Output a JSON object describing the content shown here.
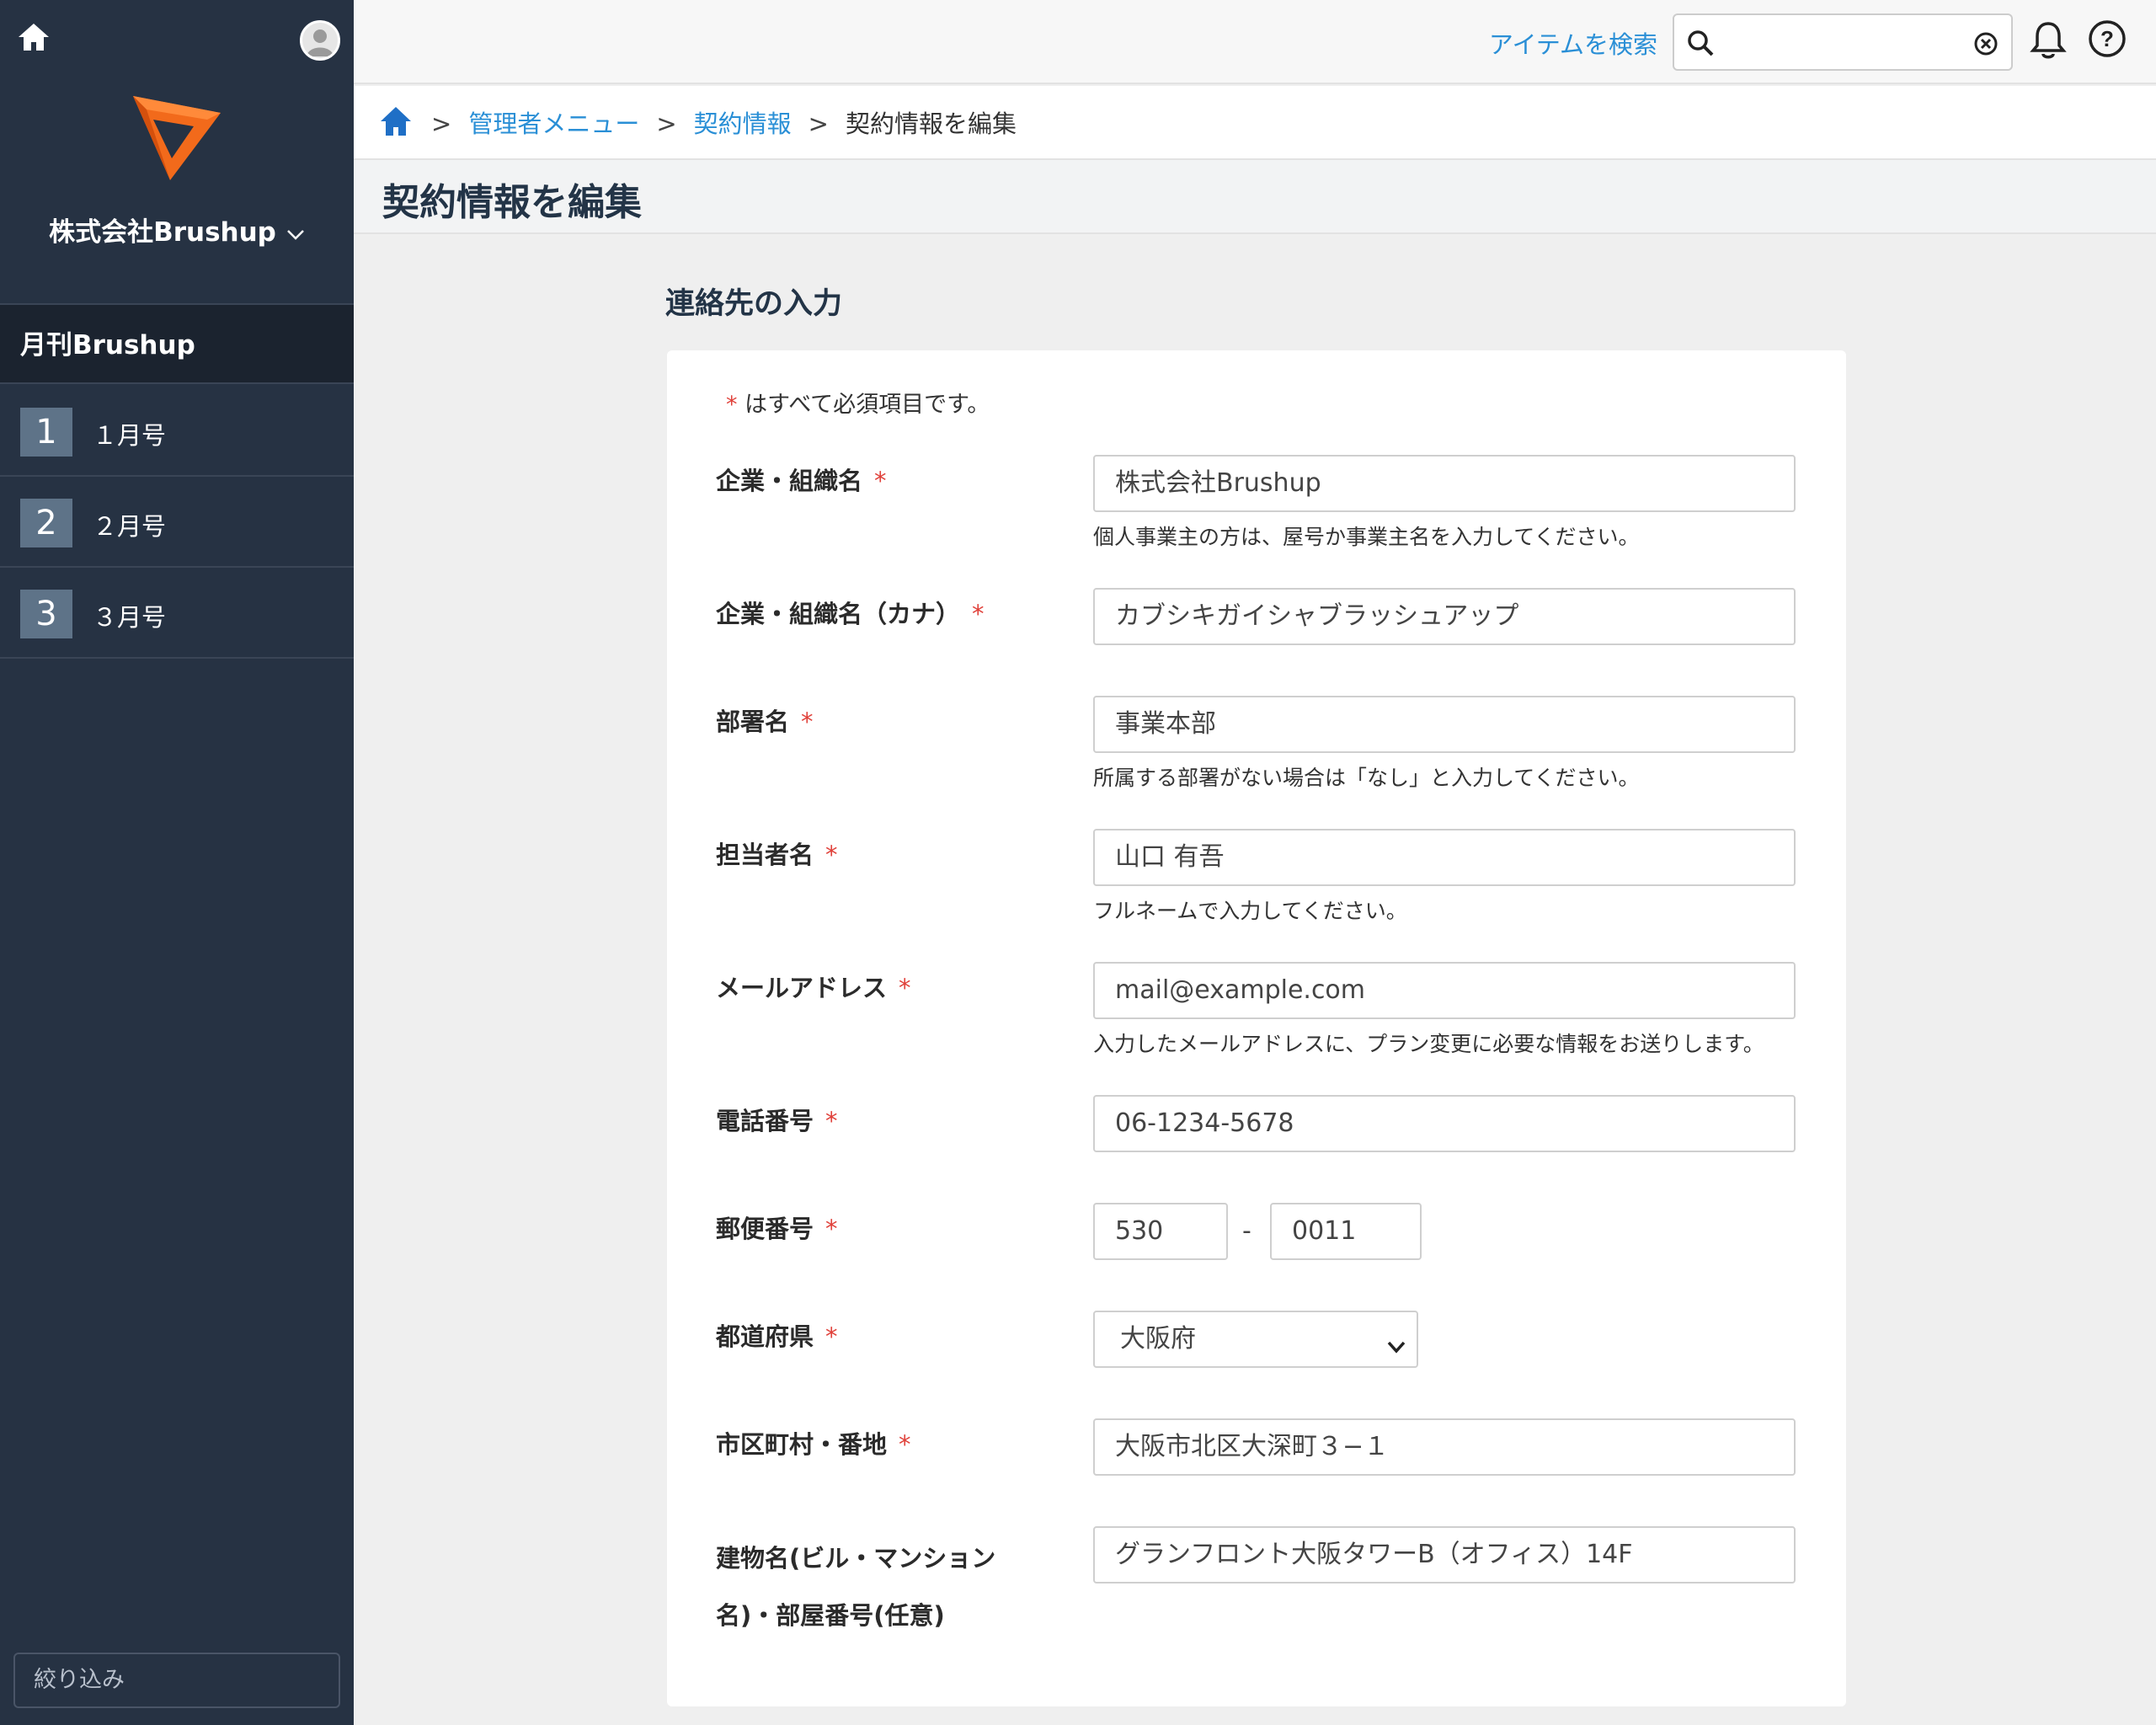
{
  "sidebar": {
    "company": "株式会社Brushup",
    "section": "月刊Brushup",
    "items": [
      {
        "num": "1",
        "label": "１月号"
      },
      {
        "num": "2",
        "label": "２月号"
      },
      {
        "num": "3",
        "label": "３月号"
      }
    ],
    "filter_placeholder": "絞り込み"
  },
  "topbar": {
    "search_link": "アイテムを検索",
    "search_value": ""
  },
  "breadcrumb": {
    "sep": ">",
    "items": [
      "管理者メニュー",
      "契約情報"
    ],
    "current": "契約情報を編集"
  },
  "page": {
    "title": "契約情報を編集"
  },
  "form": {
    "section_title": "連絡先の入力",
    "required_star": "*",
    "required_note": "はすべて必須項目です。",
    "fields": {
      "company": {
        "label": "企業・組織名",
        "value": "株式会社Brushup",
        "hint": "個人事業主の方は、屋号か事業主名を入力してください。"
      },
      "company_kana": {
        "label": "企業・組織名（カナ）",
        "value": "カブシキガイシャブラッシュアップ"
      },
      "department": {
        "label": "部署名",
        "value": "事業本部",
        "hint": "所属する部署がない場合は「なし」と入力してください。"
      },
      "contact": {
        "label": "担当者名",
        "value": "山口 有吾",
        "hint": "フルネームで入力してください。"
      },
      "email": {
        "label": "メールアドレス",
        "value": "mail@example.com",
        "hint": "入力したメールアドレスに、プラン変更に必要な情報をお送りします。"
      },
      "phone": {
        "label": "電話番号",
        "value": "06-1234-5678"
      },
      "postal": {
        "label": "郵便番号",
        "value1": "530",
        "sep": "-",
        "value2": "0011"
      },
      "prefecture": {
        "label": "都道府県",
        "value": "大阪府"
      },
      "city": {
        "label": "市区町村・番地",
        "value": "大阪市北区大深町３−１"
      },
      "building": {
        "label_line1": "建物名(ビル・マンション",
        "label_line2": "名)・部屋番号(任意)",
        "value": "グランフロント大阪タワーB（オフィス）14F"
      }
    }
  },
  "colors": {
    "sidebar_bg": "#263243",
    "link": "#2a8fd6",
    "required": "#e0413a",
    "logo_orange": "#f26a1b"
  }
}
